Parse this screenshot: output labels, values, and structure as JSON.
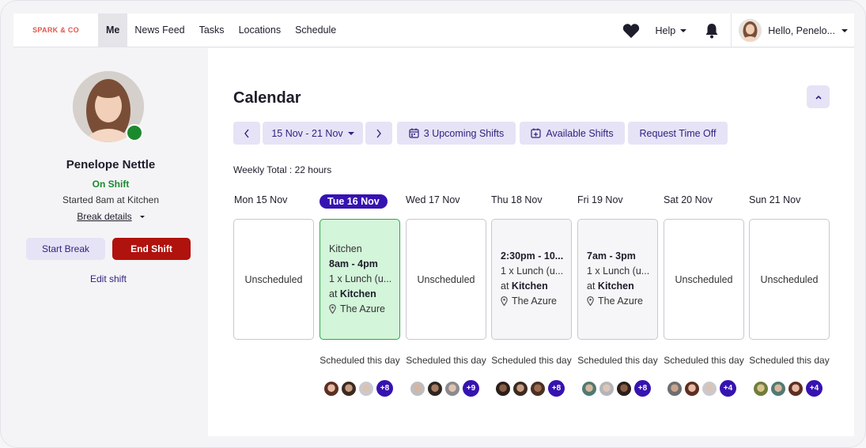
{
  "nav": {
    "logo": "SPARK & CO",
    "links": [
      "Me",
      "News Feed",
      "Tasks",
      "Locations",
      "Schedule"
    ],
    "help": "Help",
    "greeting": "Hello, Penelo..."
  },
  "sidebar": {
    "name": "Penelope Nettle",
    "status": "On Shift",
    "started": "Started 8am at Kitchen",
    "break_details": "Break details",
    "start_break": "Start Break",
    "end_shift": "End Shift",
    "edit_shift": "Edit shift"
  },
  "calendar": {
    "title": "Calendar",
    "range": "15 Nov - 21 Nov",
    "upcoming": "3 Upcoming Shifts",
    "available": "Available Shifts",
    "request": "Request Time Off",
    "weekly_total": "Weekly Total : 22 hours",
    "days": [
      {
        "label": "Mon 15 Nov",
        "card": "Unscheduled"
      },
      {
        "label": "Tue 16 Nov",
        "location": "Kitchen",
        "time": "8am - 4pm",
        "break": "1 x Lunch (u...",
        "at": "at",
        "at_loc": "Kitchen",
        "venue": "The Azure"
      },
      {
        "label": "Wed 17 Nov",
        "card": "Unscheduled"
      },
      {
        "label": "Thu 18 Nov",
        "time": "2:30pm - 10...",
        "break": "1 x Lunch (u...",
        "at": "at",
        "at_loc": "Kitchen",
        "venue": "The Azure"
      },
      {
        "label": "Fri 19 Nov",
        "time": "7am - 3pm",
        "break": "1 x Lunch (u...",
        "at": "at",
        "at_loc": "Kitchen",
        "venue": "The Azure"
      },
      {
        "label": "Sat 20 Nov",
        "card": "Unscheduled"
      },
      {
        "label": "Sun 21 Nov",
        "card": "Unscheduled"
      }
    ],
    "scheduled_label": "Scheduled this day",
    "more_counts": [
      "+8",
      "+9",
      "+8",
      "+8",
      "+4",
      "+4"
    ]
  },
  "colors": {
    "accent": "#3613b0",
    "green": "#1b8a2e",
    "danger": "#b0120d",
    "soft": "#e6e3f6"
  }
}
